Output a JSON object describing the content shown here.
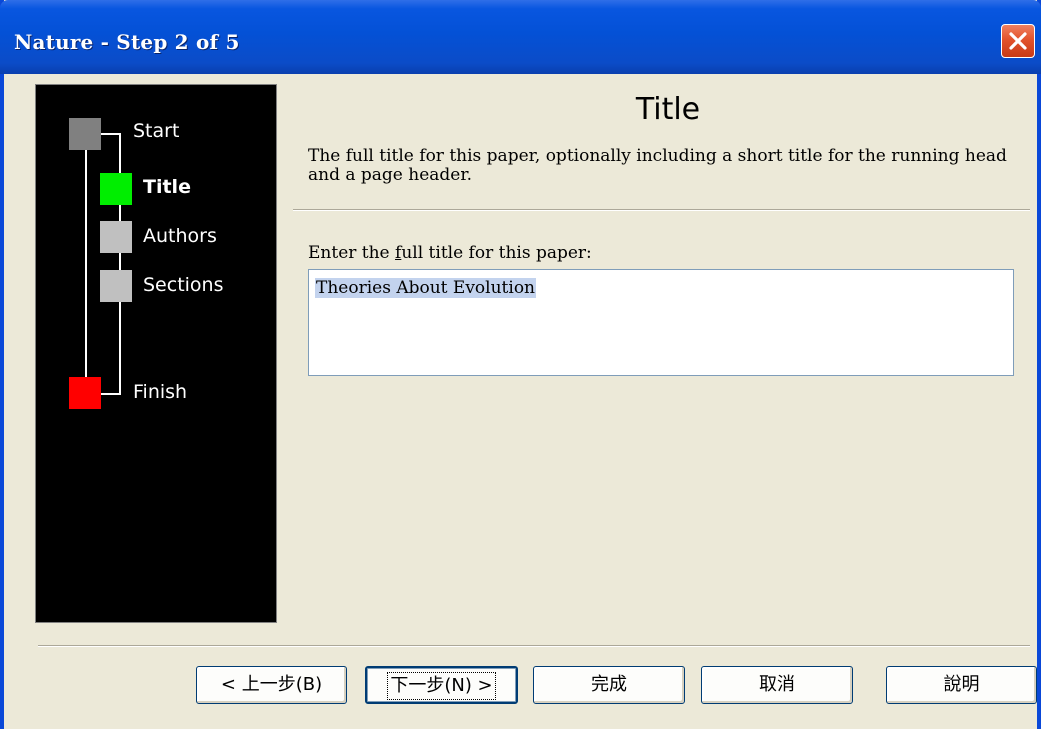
{
  "window": {
    "title": "Nature - Step 2 of 5"
  },
  "steps": [
    {
      "label": "Start",
      "color": "#808080"
    },
    {
      "label": "Title",
      "color": "#00ee00",
      "current": true
    },
    {
      "label": "Authors",
      "color": "#c0c0c0"
    },
    {
      "label": "Sections",
      "color": "#c0c0c0"
    },
    {
      "label": "Finish",
      "color": "#ff0000"
    }
  ],
  "page": {
    "title": "Title",
    "description": "The full title for this paper, optionally including a short title for the running head and a page header.",
    "field_label_pre": "Enter the ",
    "field_label_mnemonic": "f",
    "field_label_post": "ull title for this paper:",
    "title_value": "Theories About Evolution"
  },
  "buttons": {
    "back": "< 上一步(B)",
    "next": "下一步(N) >",
    "finish": "完成",
    "cancel": "取消",
    "help": "說明"
  },
  "colors": {
    "titlebar": "#0451d6",
    "dialog_bg": "#ece9d8",
    "selection": "#c3d3ee"
  }
}
